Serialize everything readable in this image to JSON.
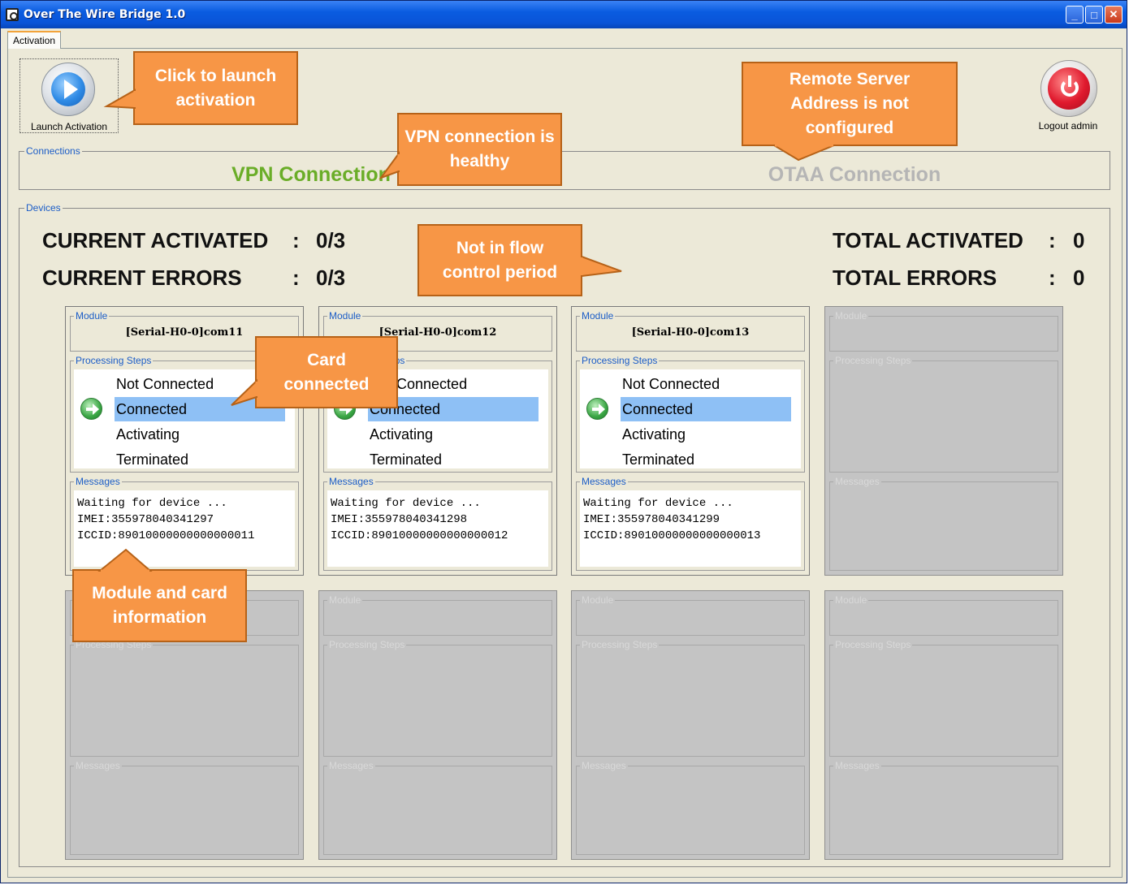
{
  "window": {
    "title": "Over The Wire Bridge 1.0",
    "buttons": {
      "minimize": "_",
      "maximize": "□",
      "close": "✕"
    }
  },
  "tabs": [
    {
      "label": "Activation",
      "active": true
    }
  ],
  "toolbar": {
    "launch_label": "Launch Activation",
    "logout_label": "Logout admin"
  },
  "connections": {
    "legend": "Connections",
    "vpn": {
      "label": "VPN Connection",
      "color": "#6aad28"
    },
    "otaa": {
      "label": "OTAA Connection",
      "color": "#b5b5b5"
    }
  },
  "devices": {
    "legend": "Devices",
    "stats": {
      "current_activated": {
        "label": "CURRENT ACTIVATED",
        "colon": ":",
        "value": "0/3"
      },
      "current_errors": {
        "label": "CURRENT ERRORS",
        "colon": ":",
        "value": "0/3"
      },
      "total_activated": {
        "label": "TOTAL ACTIVATED",
        "colon": ":",
        "value": "0"
      },
      "total_errors": {
        "label": "TOTAL ERRORS",
        "colon": ":",
        "value": "0"
      }
    },
    "module_legend": "Module",
    "steps_legend": "Processing Steps",
    "messages_legend": "Messages",
    "step_labels": [
      "Not Connected",
      "Connected",
      "Activating",
      "Terminated"
    ],
    "cards": [
      {
        "module": "[Serial-H0-0]com11",
        "active_step": "Connected",
        "messages": [
          "Waiting for device ...",
          "IMEI:355978040341297",
          "ICCID:89010000000000000011"
        ]
      },
      {
        "module": "[Serial-H0-0]com12",
        "active_step": "Connected",
        "messages": [
          "Waiting for device ...",
          "IMEI:355978040341298",
          "ICCID:89010000000000000012"
        ]
      },
      {
        "module": "[Serial-H0-0]com13",
        "active_step": "Connected",
        "messages": [
          "Waiting for device ...",
          "IMEI:355978040341299",
          "ICCID:89010000000000000013"
        ]
      }
    ],
    "empty_card_count": 5
  },
  "callouts": {
    "launch": "Click to launch activation",
    "vpn": "VPN connection is healthy",
    "remote": "Remote Server Address is not configured",
    "flow": "Not in flow control period",
    "card": "Card connected",
    "module": "Module and card information"
  },
  "colors": {
    "callout_fill": "#f79646",
    "selected_step": "#8ec0f5",
    "legend_text": "#1c5dc7"
  }
}
